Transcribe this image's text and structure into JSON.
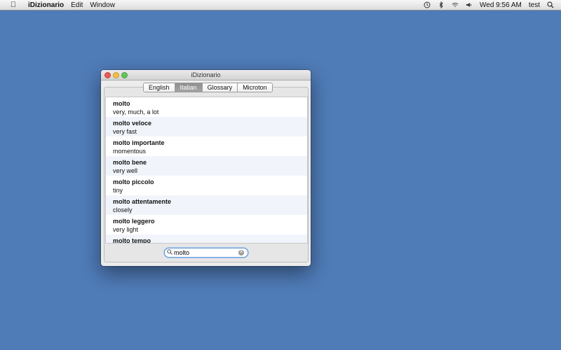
{
  "menubar": {
    "app_name": "iDizionario",
    "menus": [
      "Edit",
      "Window"
    ],
    "clock": "Wed 9:56 AM",
    "user": "test",
    "status_icons": [
      "time-machine-icon",
      "bluetooth-icon",
      "wifi-icon",
      "volume-icon"
    ]
  },
  "window": {
    "title": "iDizionario",
    "tabs": [
      {
        "label": "English"
      },
      {
        "label": "Italian"
      },
      {
        "label": "Glossary"
      },
      {
        "label": "Microton"
      }
    ],
    "selected_tab": "Italian",
    "entries": [
      {
        "word": "molto",
        "translation": "very, much, a lot"
      },
      {
        "word": "molto veloce",
        "translation": "very fast"
      },
      {
        "word": "molto importante",
        "translation": "momentous"
      },
      {
        "word": "molto bene",
        "translation": "very well"
      },
      {
        "word": "molto piccolo",
        "translation": "tiny"
      },
      {
        "word": "molto attentamente",
        "translation": "closely"
      },
      {
        "word": "molto leggero",
        "translation": "very light"
      },
      {
        "word": "molto tempo",
        "translation": ""
      }
    ],
    "search": {
      "value": "molto",
      "placeholder": ""
    }
  },
  "colors": {
    "desktop": "#4f7bb7",
    "selected_tab": "#8f8f8f",
    "search_focus": "#6a9ed8"
  }
}
